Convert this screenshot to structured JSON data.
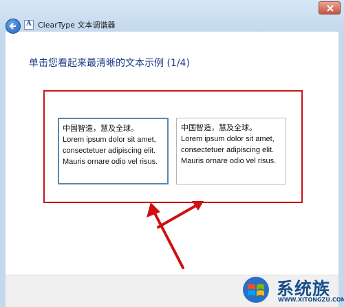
{
  "window": {
    "app_icon_letter": "A",
    "title": "ClearType 文本调谐器",
    "close_glyph": "×"
  },
  "page": {
    "heading": "单击您看起来最清晰的文本示例 (1/4)"
  },
  "samples": [
    {
      "cn": "中国智造，慧及全球。",
      "en": "Lorem ipsum dolor sit amet, consectetuer adipiscing elit. Mauris ornare odio vel risus."
    },
    {
      "cn": "中国智造，慧及全球。",
      "en": "Lorem ipsum dolor sit amet, consectetuer adipiscing elit. Mauris ornare odio vel risus."
    }
  ],
  "watermark": {
    "name": "系统族",
    "url": "WWW.XITONGZU.COM"
  },
  "colors": {
    "highlight": "#c4161c",
    "heading": "#1e3a8a",
    "selected_border": "#5b88aa"
  }
}
